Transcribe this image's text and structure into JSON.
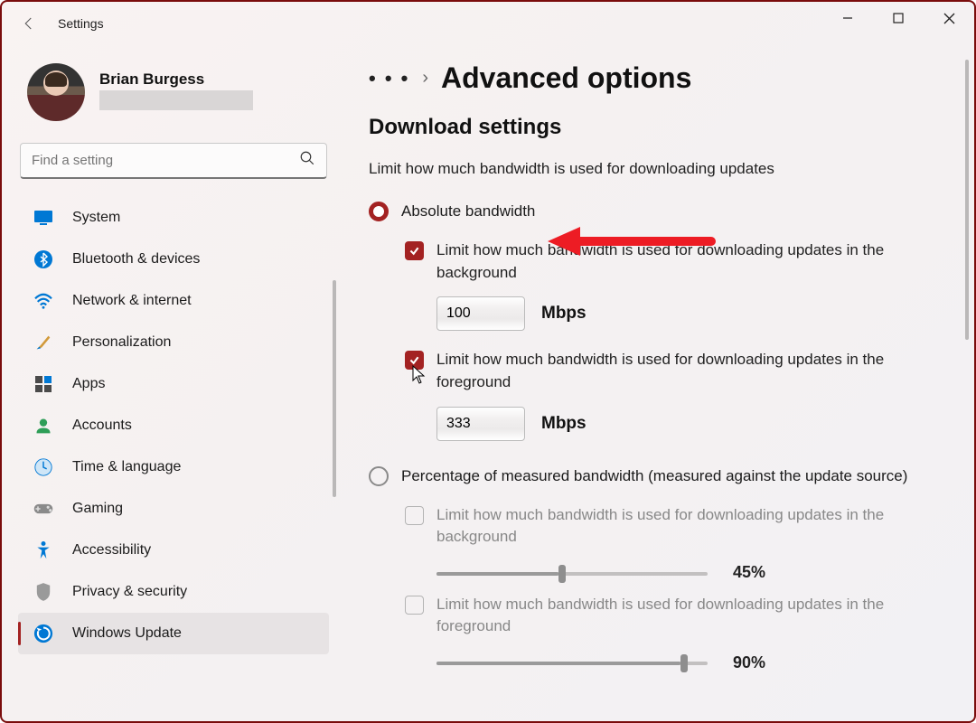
{
  "app": {
    "title": "Settings"
  },
  "profile": {
    "name": "Brian Burgess"
  },
  "search": {
    "placeholder": "Find a setting"
  },
  "sidebar": {
    "items": [
      {
        "label": "System"
      },
      {
        "label": "Bluetooth & devices"
      },
      {
        "label": "Network & internet"
      },
      {
        "label": "Personalization"
      },
      {
        "label": "Apps"
      },
      {
        "label": "Accounts"
      },
      {
        "label": "Time & language"
      },
      {
        "label": "Gaming"
      },
      {
        "label": "Accessibility"
      },
      {
        "label": "Privacy & security"
      },
      {
        "label": "Windows Update"
      }
    ]
  },
  "page": {
    "title": "Advanced options",
    "section_heading": "Download settings",
    "section_desc": "Limit how much bandwidth is used for downloading updates",
    "radio1_label": "Absolute bandwidth",
    "radio2_label": "Percentage of measured bandwidth (measured against the update source)",
    "bg_check_label": "Limit how much bandwidth is used for downloading updates in the background",
    "bg_value": "100",
    "bg_unit": "Mbps",
    "fg_check_label": "Limit how much bandwidth is used for downloading updates in the foreground",
    "fg_value": "333",
    "fg_unit": "Mbps",
    "pct_bg_label": "Limit how much bandwidth is used for downloading updates in the background",
    "pct_bg_value": "45%",
    "pct_fg_label": "Limit how much bandwidth is used for downloading updates in the foreground",
    "pct_fg_value": "90%"
  }
}
